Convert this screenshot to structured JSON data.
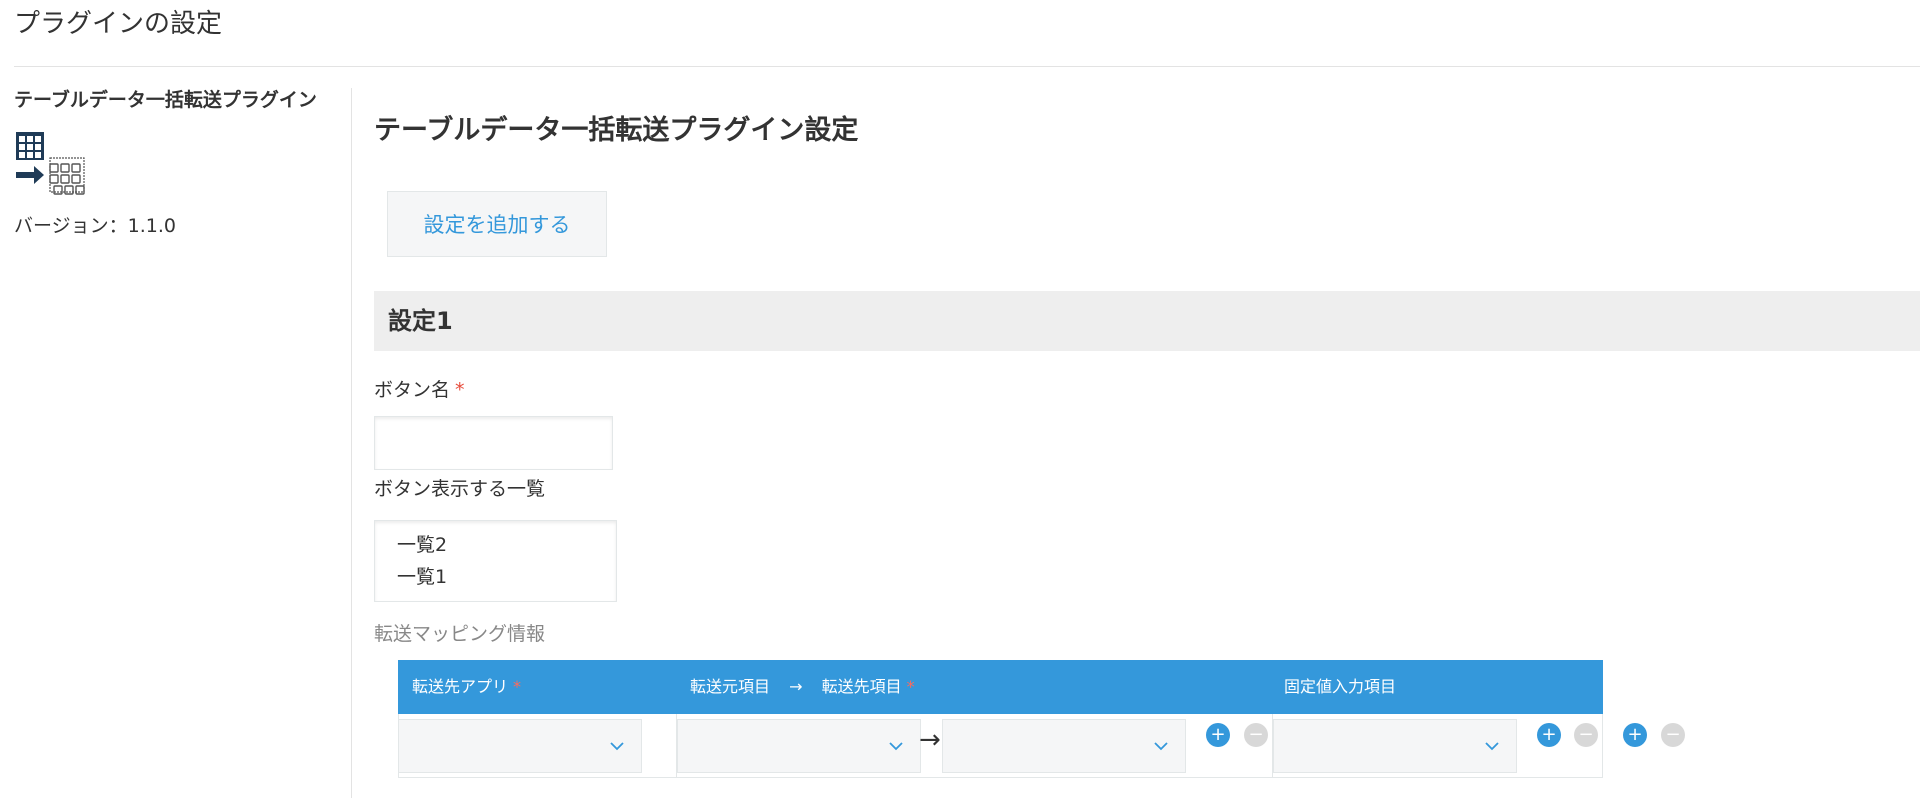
{
  "page": {
    "title": "プラグインの設定"
  },
  "plugin": {
    "name": "テーブルデータ一括転送プラグイン",
    "icon": "table-transfer-icon",
    "version": "バージョン：1.1.0"
  },
  "settings": {
    "title": "テーブルデータ一括転送プラグイン設定",
    "add_button_label": "設定を追加する",
    "section_title": "設定1",
    "button_name_label": "ボタン名",
    "button_name_value": "",
    "required_mark": "*",
    "list_label": "ボタン表示する一覧",
    "list_options": [
      "一覧2",
      "一覧1"
    ],
    "mapping_label": "転送マッピング情報",
    "table": {
      "columns": {
        "dest_app": "転送先アプリ",
        "source_field": "転送元項目",
        "arrow": "→",
        "dest_field": "転送先項目",
        "fixed_field": "固定値入力項目"
      },
      "row_arrow": "→",
      "add_glyph": "+",
      "remove_glyph": "−",
      "selects": {
        "dest_app": "",
        "source_field": "",
        "dest_field": "",
        "fixed_field": ""
      }
    }
  },
  "colors": {
    "accent": "#3498db",
    "required": "#e74c3c",
    "section_bg": "#eeeeee",
    "disabled_button": "#d8d8d8"
  }
}
